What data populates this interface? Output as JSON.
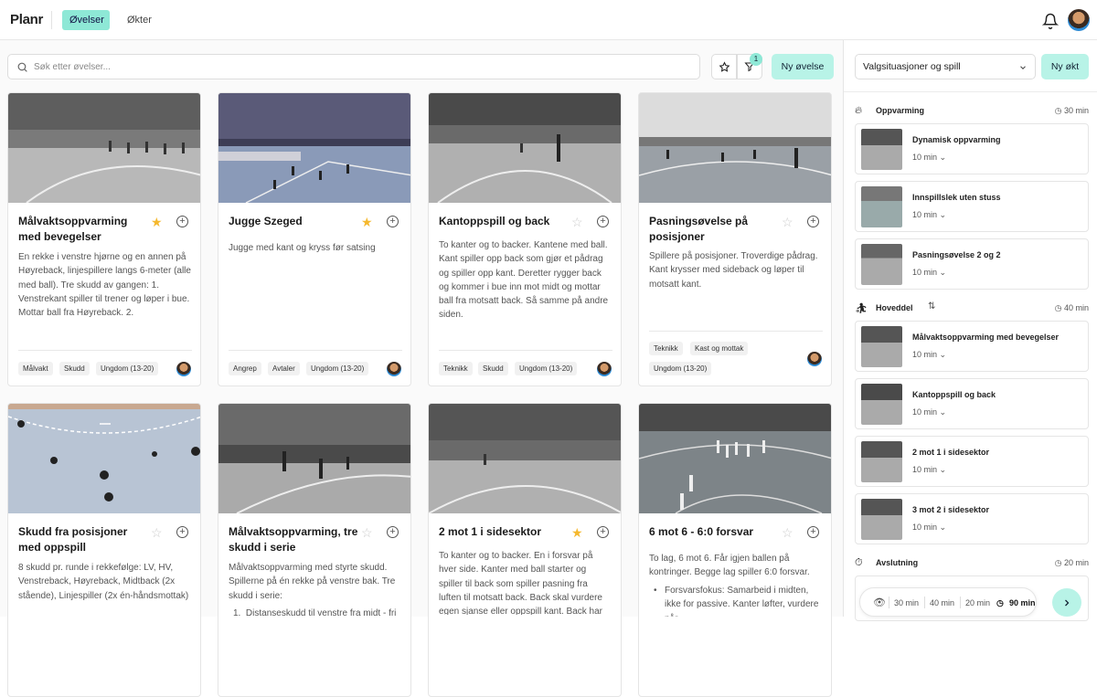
{
  "app": {
    "logo": "Planr",
    "nav": [
      "Øvelser",
      "Økter"
    ]
  },
  "toolbar": {
    "search_placeholder": "Søk etter øvelser...",
    "filter_count": "1",
    "new_button": "Ny øvelse"
  },
  "cards": [
    {
      "title": "Målvaktsoppvarming med bevegelser",
      "starred": true,
      "desc": "En rekke i venstre hjørne og en annen på Høyreback, linjespillere langs 6-meter (alle med ball). Tre skudd av gangen: 1. Venstrekant spiller til trener og løper i bue. Mottar ball fra Høyreback. 2.",
      "tags": [
        "Målvakt",
        "Skudd",
        "Ungdom (13-20)"
      ]
    },
    {
      "title": "Jugge Szeged",
      "starred": true,
      "desc": "Jugge med kant og kryss før satsing",
      "tags": [
        "Angrep",
        "Avtaler",
        "Ungdom (13-20)"
      ]
    },
    {
      "title": "Kantoppspill og back",
      "starred": false,
      "desc": "To kanter og to backer. Kantene med ball. Kant spiller opp back som gjør et pådrag og spiller opp kant. Deretter rygger back og kommer i bue inn mot midt og mottar ball fra motsatt back. Så samme på andre siden.",
      "tags": [
        "Teknikk",
        "Skudd",
        "Ungdom (13-20)"
      ]
    },
    {
      "title": "Pasningsøvelse på posisjoner",
      "starred": false,
      "desc": "Spillere på posisjoner. Troverdige pådrag. Kant krysser med sideback og løper til motsatt kant.",
      "tags": [
        "Teknikk",
        "Kast og mottak",
        "Ungdom (13-20)"
      ]
    },
    {
      "title": "Skudd fra posisjoner med oppspill",
      "starred": false,
      "desc": "8 skudd pr. runde i rekkefølge: LV, HV, Venstreback, Høyreback, Midtback (2x stående), Linjespiller (2x én-håndsmottak)",
      "tags": []
    },
    {
      "title": "Målvaktsoppvarming, tre skudd i serie",
      "starred": false,
      "desc": "Målvaktsoppvarming med styrte skudd. Spillerne på én rekke på venstre bak. Tre skudd i serie:",
      "list": "Distanseskudd til venstre fra midt - fri",
      "tags": []
    },
    {
      "title": "2 mot 1 i sidesektor",
      "starred": true,
      "desc": "To kanter og to backer. En i forsvar på hver side. Kanter med ball starter og spiller til back som spiller pasning fra luften til motsatt back. Back skal vurdere egen sjanse eller oppspill kant. Back har",
      "tags": []
    },
    {
      "title": "6 mot 6 - 6:0 forsvar",
      "starred": false,
      "desc": "To lag, 6 mot 6. Får igjen ballen på kontringer. Begge lag spiller 6:0 forsvar.",
      "bullet": "Forsvarsfokus: Samarbeid i midten, ikke for passive. Kanter løfter, vurdere når",
      "tags": []
    }
  ],
  "session": {
    "select_value": "Valgsituasjoner og spill",
    "new_button": "Ny økt",
    "sections": [
      {
        "name": "Oppvarming",
        "duration": "30 min",
        "items": [
          {
            "title": "Dynamisk oppvarming",
            "duration": "10 min"
          },
          {
            "title": "Innspillslek uten stuss",
            "duration": "10 min"
          },
          {
            "title": "Pasningsøvelse 2 og 2",
            "duration": "10 min"
          }
        ]
      },
      {
        "name": "Hoveddel",
        "duration": "40 min",
        "items": [
          {
            "title": "Målvaktsoppvarming med bevegelser",
            "duration": "10 min"
          },
          {
            "title": "Kantoppspill og back",
            "duration": "10 min"
          },
          {
            "title": "2 mot 1 i sidesektor",
            "duration": "10 min"
          },
          {
            "title": "3 mot 2 i sidesektor",
            "duration": "10 min"
          }
        ]
      },
      {
        "name": "Avslutning",
        "duration": "20 min",
        "items": []
      }
    ],
    "durations": [
      "30 min",
      "40 min",
      "20 min",
      "90 min"
    ]
  },
  "colors": {
    "accent": "#8ee8d6",
    "accent_light": "#b8f3e7",
    "star": "#f5b82e"
  }
}
